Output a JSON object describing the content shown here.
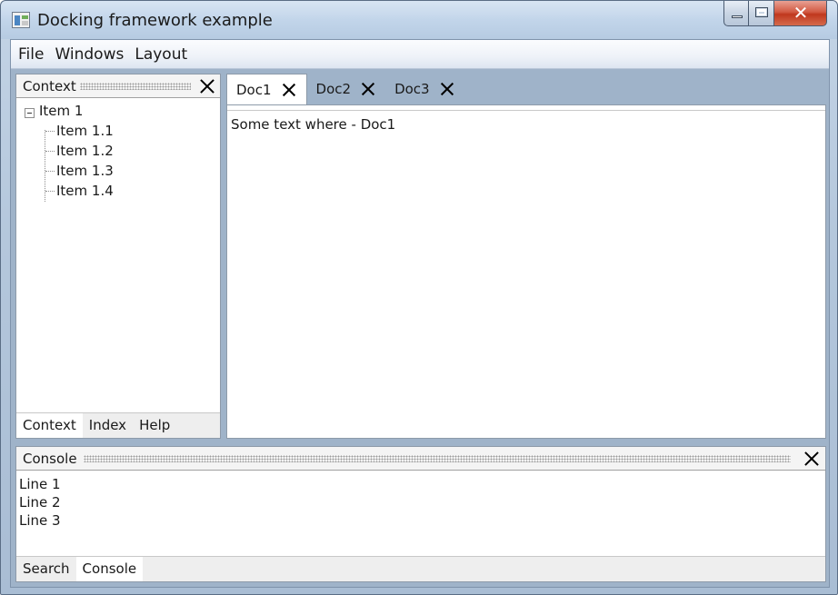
{
  "window": {
    "title": "Docking framework example"
  },
  "menu": {
    "items": [
      "File",
      "Windows",
      "Layout"
    ]
  },
  "context_panel": {
    "title": "Context",
    "tree": {
      "root": "Item 1",
      "children": [
        "Item 1.1",
        "Item 1.2",
        "Item 1.3",
        "Item 1.4"
      ]
    },
    "tabs": [
      "Context",
      "Index",
      "Help"
    ],
    "active_tab": "Context"
  },
  "documents": {
    "tabs": [
      "Doc1",
      "Doc2",
      "Doc3"
    ],
    "active_tab": "Doc1",
    "content": "Some text where - Doc1"
  },
  "console_panel": {
    "title": "Console",
    "lines": [
      "Line 1",
      "Line 2",
      "Line 3"
    ],
    "tabs": [
      "Search",
      "Console"
    ],
    "active_tab": "Console"
  },
  "icons": {
    "app": "app-window-icon",
    "minimize": "minimize-icon",
    "maximize": "maximize-icon",
    "close": "close-icon",
    "collapse": "collapse-icon"
  },
  "colors": {
    "close_button": "#c0381e",
    "frame": "#a9bdd4"
  }
}
